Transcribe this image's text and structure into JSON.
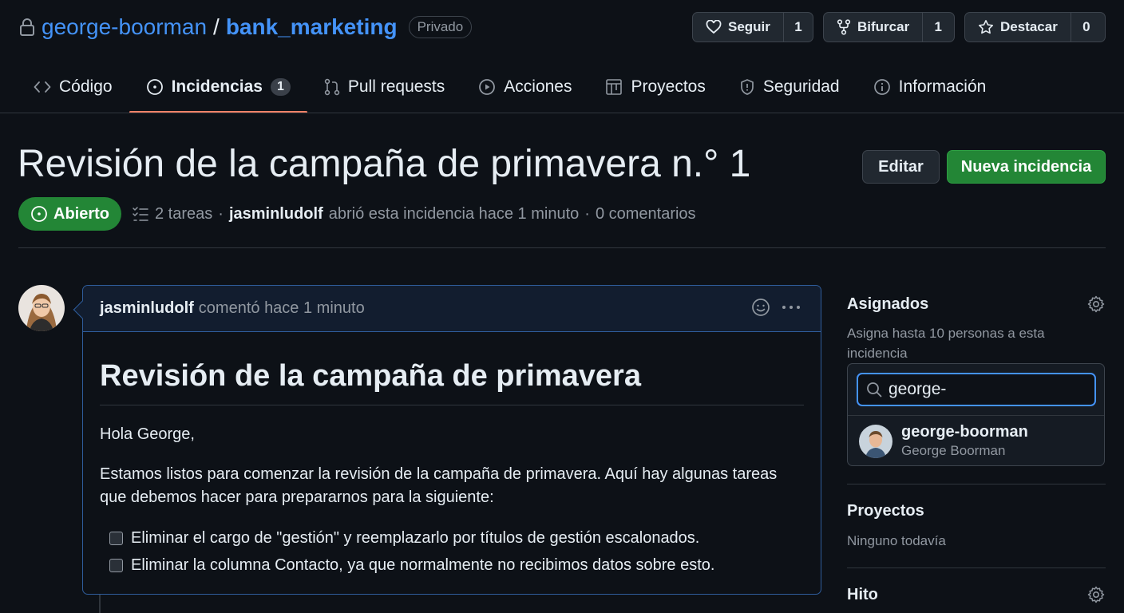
{
  "repo": {
    "owner": "george-boorman",
    "separator": "/",
    "name": "bank_marketing",
    "visibility": "Privado"
  },
  "actions": {
    "watch": {
      "label": "Seguir",
      "count": "1"
    },
    "fork": {
      "label": "Bifurcar",
      "count": "1"
    },
    "star": {
      "label": "Destacar",
      "count": "0"
    }
  },
  "tabs": [
    {
      "label": "Código",
      "icon": "code-icon"
    },
    {
      "label": "Incidencias",
      "icon": "issue-icon",
      "count": "1",
      "active": true
    },
    {
      "label": "Pull requests",
      "icon": "pull-request-icon"
    },
    {
      "label": "Acciones",
      "icon": "play-icon"
    },
    {
      "label": "Proyectos",
      "icon": "table-icon"
    },
    {
      "label": "Seguridad",
      "icon": "shield-icon"
    },
    {
      "label": "Información",
      "icon": "info-icon"
    }
  ],
  "issue": {
    "title": "Revisión de la campaña de primavera n.° 1",
    "edit_label": "Editar",
    "new_label": "Nueva incidencia",
    "state": "Abierto",
    "tasks": "2 tareas",
    "dot": "·",
    "author": "jasminludolf",
    "opened_text": "abrió esta incidencia hace 1 minuto",
    "comments": "0 comentarios"
  },
  "comment": {
    "author": "jasminludolf",
    "action": "comentó hace 1 minuto",
    "heading": "Revisión de la campaña de primavera",
    "greeting": "Hola George,",
    "paragraph_line1": "Estamos listos para comenzar la revisión de la campaña de primavera. Aquí hay algunas tareas",
    "paragraph_line2": "que debemos hacer para prepararnos para la siguiente:",
    "tasks": [
      "Eliminar el cargo de \"gestión\" y reemplazarlo por títulos de gestión escalonados.",
      "Eliminar la columna Contacto, ya que normalmente no recibimos datos sobre esto."
    ]
  },
  "sidebar": {
    "assignees_title": "Asignados",
    "assignees_hint_line1": "Asigna hasta 10 personas a esta",
    "assignees_hint_line2": "incidencia",
    "search_value": "george-",
    "suggestion": {
      "login": "george-boorman",
      "name": "George Boorman"
    },
    "projects_title": "Proyectos",
    "projects_value": "Ninguno todavía",
    "milestone_title": "Hito"
  },
  "colors": {
    "background": "#0d1117",
    "link": "#4493f8",
    "open_green": "#238636",
    "tab_underline": "#f78166",
    "comment_header": "#121d2f"
  }
}
